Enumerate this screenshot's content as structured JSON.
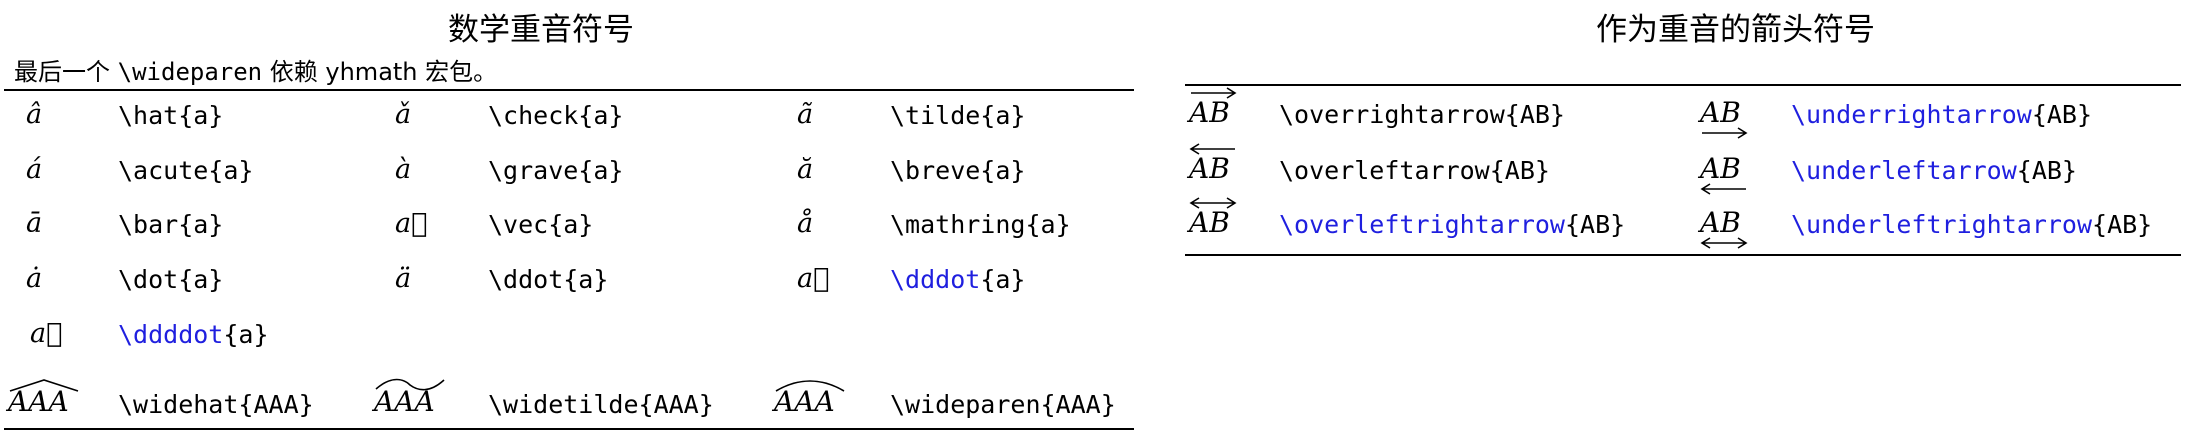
{
  "left": {
    "title": "数学重音符号",
    "note_prefix": "最后一个 ",
    "note_code": "\\wideparen",
    "note_suffix": " 依赖 yhmath 宏包。",
    "rows": [
      [
        {
          "sym": "â",
          "cmd": "\\hat{a}"
        },
        {
          "sym": "ǎ",
          "cmd": "\\check{a}"
        },
        {
          "sym": "ã",
          "cmd": "\\tilde{a}"
        }
      ],
      [
        {
          "sym": "á",
          "cmd": "\\acute{a}"
        },
        {
          "sym": "à",
          "cmd": "\\grave{a}"
        },
        {
          "sym": "ă",
          "cmd": "\\breve{a}"
        }
      ],
      [
        {
          "sym": "ā",
          "cmd": "\\bar{a}"
        },
        {
          "sym": "a⃗",
          "cmd": "\\vec{a}"
        },
        {
          "sym": "å",
          "cmd": "\\mathring{a}"
        }
      ],
      [
        {
          "sym": "ȧ",
          "cmd": "\\dot{a}"
        },
        {
          "sym": "ä",
          "cmd": "\\ddot{a}"
        },
        {
          "sym": "a⃛",
          "cmd_blue": "\\dddot",
          "cmd_rest": "{a}"
        }
      ],
      [
        {
          "sym": "a⃜",
          "cmd_blue": "\\ddddot",
          "cmd_rest": "{a}"
        }
      ]
    ],
    "wide": [
      {
        "sym": "AAA",
        "cmd": "\\widehat{AAA}",
        "accent": "hat"
      },
      {
        "sym": "AAA",
        "cmd": "\\widetilde{AAA}",
        "accent": "tilde"
      },
      {
        "sym": "AAA",
        "cmd": "\\wideparen{AAA}",
        "accent": "paren"
      }
    ]
  },
  "right": {
    "title": "作为重音的箭头符号",
    "rows": [
      [
        {
          "sym": "AB",
          "accent": "over-right",
          "cmd": "\\overrightarrow{AB}"
        },
        {
          "sym": "AB",
          "accent": "under-right",
          "cmd_blue": "\\underrightarrow",
          "cmd_rest": "{AB}"
        }
      ],
      [
        {
          "sym": "AB",
          "accent": "over-left",
          "cmd": "\\overleftarrow{AB}"
        },
        {
          "sym": "AB",
          "accent": "under-left",
          "cmd_blue": "\\underleftarrow",
          "cmd_rest": "{AB}"
        }
      ],
      [
        {
          "sym": "AB",
          "accent": "over-both",
          "cmd_blue": "\\overleftrightarrow",
          "cmd_rest": "{AB}"
        },
        {
          "sym": "AB",
          "accent": "under-both",
          "cmd_blue": "\\underleftrightarrow",
          "cmd_rest": "{AB}"
        }
      ]
    ]
  },
  "colors": {
    "link_blue": "#1f1fdf",
    "text": "#000000",
    "rule": "#000000"
  }
}
